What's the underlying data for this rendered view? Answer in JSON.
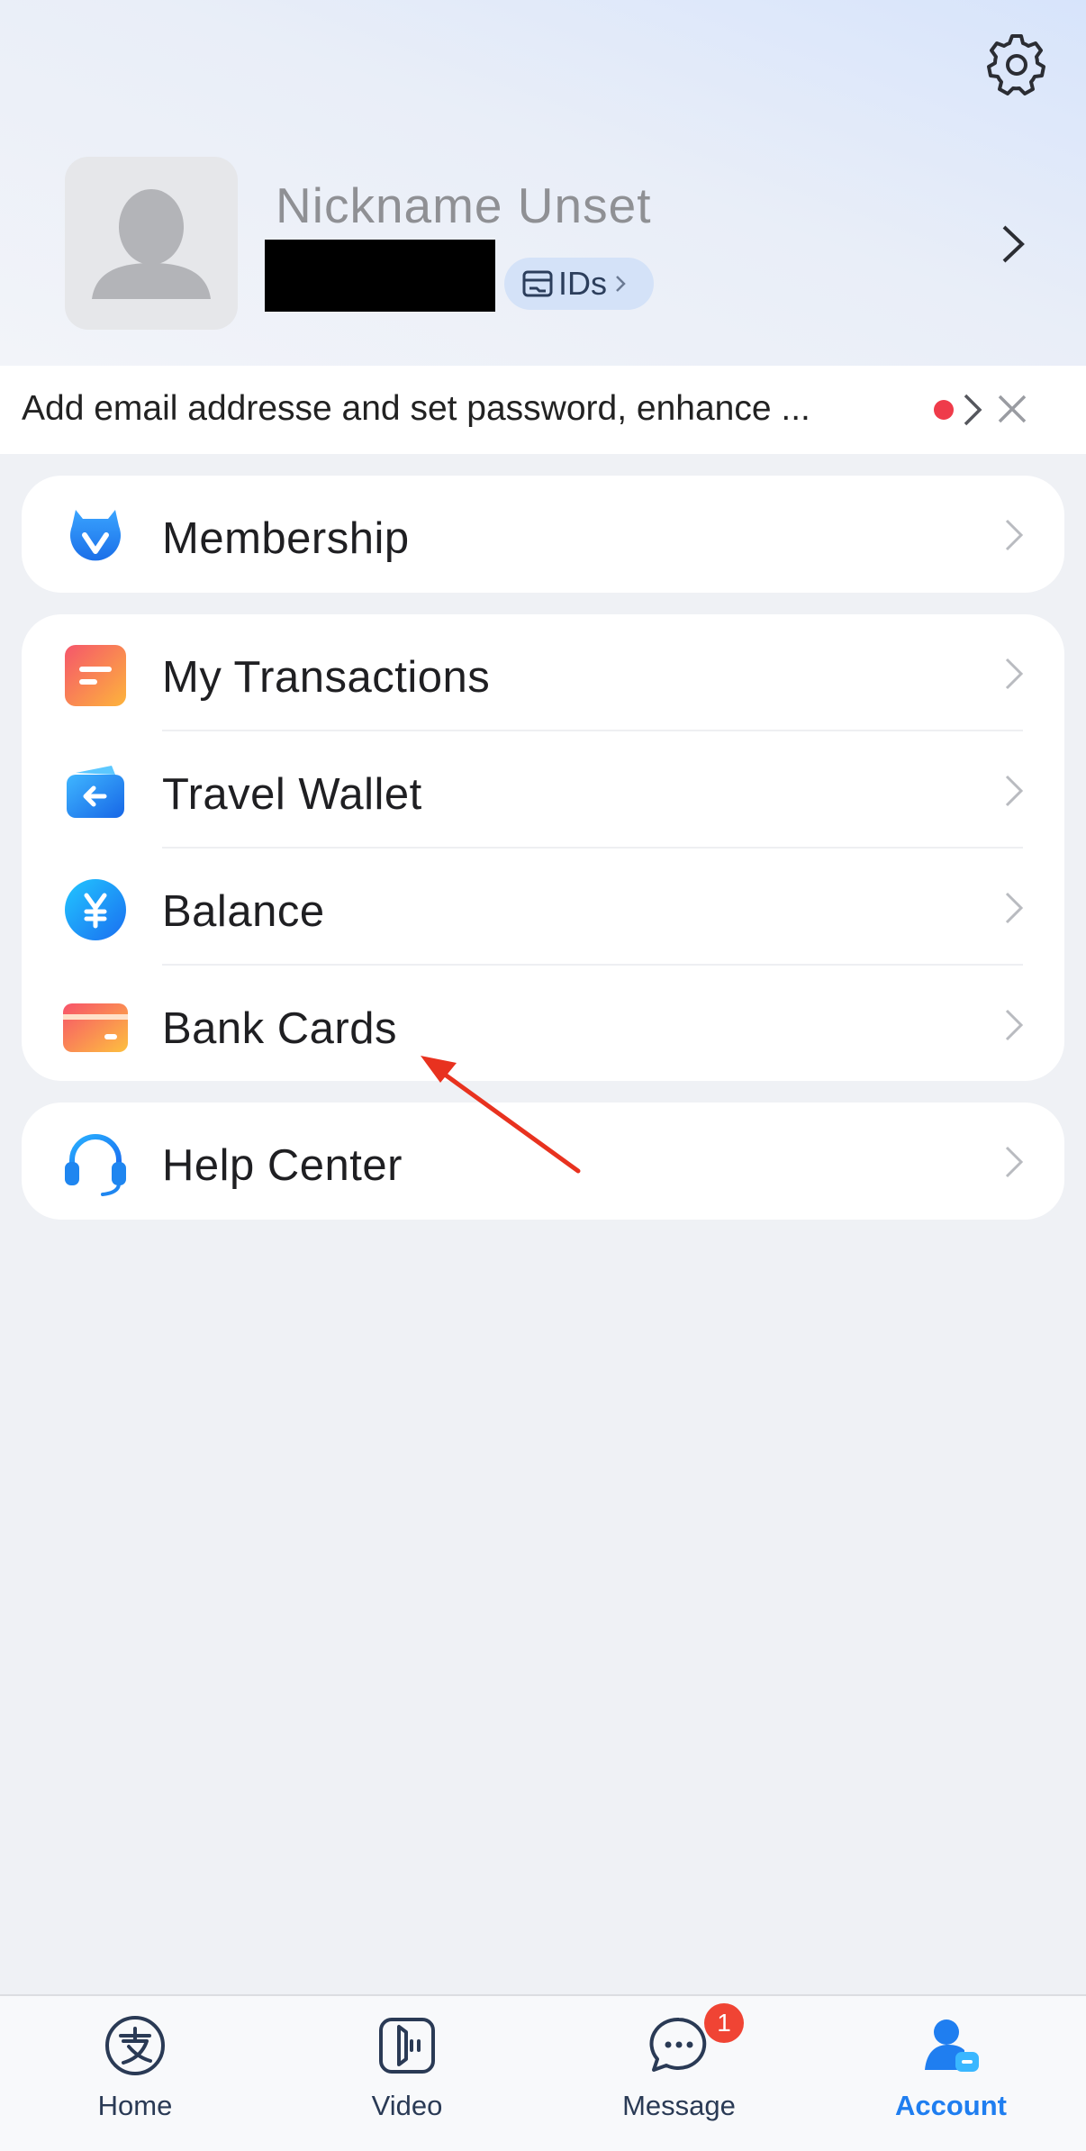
{
  "profile": {
    "nickname": "Nickname Unset",
    "ids_label": "IDs"
  },
  "banner": {
    "text": "Add email addresse and set password, enhance ...",
    "dot_color": "#ef3b4a"
  },
  "menu_groups": [
    {
      "items": [
        {
          "label": "Membership",
          "icon": "membership-icon"
        }
      ]
    },
    {
      "items": [
        {
          "label": "My Transactions",
          "icon": "transactions-icon"
        },
        {
          "label": "Travel Wallet",
          "icon": "wallet-icon"
        },
        {
          "label": "Balance",
          "icon": "yuan-icon"
        },
        {
          "label": "Bank Cards",
          "icon": "bank-card-icon"
        }
      ]
    },
    {
      "items": [
        {
          "label": "Help Center",
          "icon": "headset-icon"
        }
      ]
    }
  ],
  "tabbar": {
    "tabs": [
      {
        "label": "Home",
        "icon": "alipay-home-icon"
      },
      {
        "label": "Video",
        "icon": "video-icon"
      },
      {
        "label": "Message",
        "icon": "message-icon",
        "badge": "1"
      },
      {
        "label": "Account",
        "icon": "account-icon",
        "active": true
      }
    ]
  },
  "colors": {
    "accent": "#1f7ef0",
    "badge": "#f04434",
    "annotation_arrow": "#e8321f"
  }
}
